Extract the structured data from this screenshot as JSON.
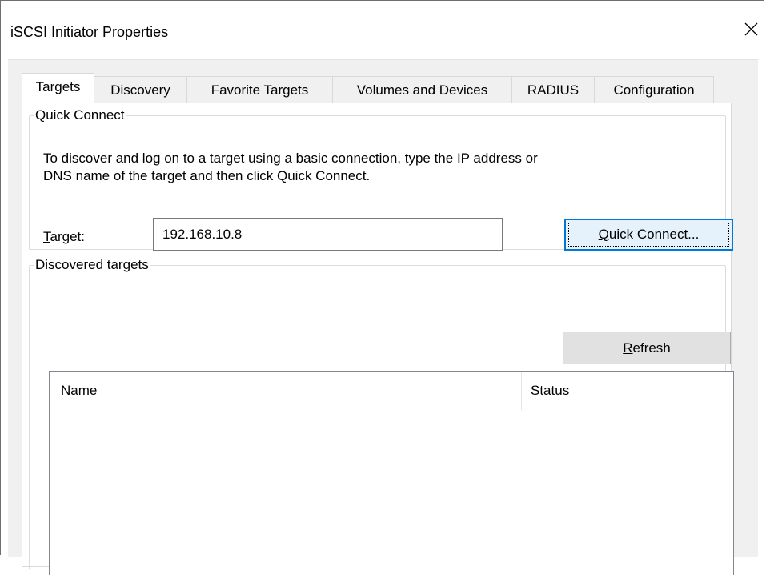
{
  "window": {
    "title": "iSCSI Initiator Properties",
    "close_icon": "close-icon"
  },
  "tabs": [
    {
      "label": "Targets",
      "active": true
    },
    {
      "label": "Discovery",
      "active": false
    },
    {
      "label": "Favorite Targets",
      "active": false
    },
    {
      "label": "Volumes and Devices",
      "active": false
    },
    {
      "label": "RADIUS",
      "active": false
    },
    {
      "label": "Configuration",
      "active": false
    }
  ],
  "quick_connect": {
    "legend": "Quick Connect",
    "description_line1": "To discover and log on to a target using a basic connection, type the IP address or",
    "description_line2": "DNS name of the target and then click Quick Connect.",
    "target_label_accel": "T",
    "target_label_rest": "arget:",
    "target_value": "192.168.10.8",
    "button_accel": "Q",
    "button_rest": "uick Connect..."
  },
  "discovered_targets": {
    "legend_part1": "Discovered tar",
    "legend_accel": "g",
    "legend_part2": "ets",
    "refresh_accel": "R",
    "refresh_rest": "efresh",
    "columns": [
      "Name",
      "Status"
    ],
    "rows": []
  },
  "colors": {
    "focus_border": "#0078d7",
    "dialog_background": "#f0f0f0",
    "panel_background": "#ffffff"
  }
}
